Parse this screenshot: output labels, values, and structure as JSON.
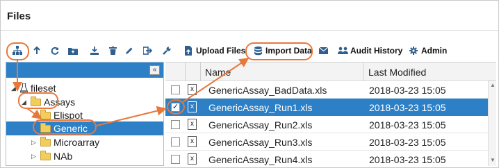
{
  "panel": {
    "title": "Files"
  },
  "toolbar": {
    "upload_label": "Upload Files",
    "import_label": "Import Data",
    "audit_label": "Audit History",
    "admin_label": "Admin"
  },
  "tree": {
    "collapse_glyph": "«",
    "root": "fileset",
    "items": [
      {
        "label": "Assays"
      },
      {
        "label": "Elispot"
      },
      {
        "label": "Generic"
      },
      {
        "label": "Microarray"
      },
      {
        "label": "NAb"
      }
    ]
  },
  "grid": {
    "columns": {
      "name": "Name",
      "modified": "Last Modified"
    },
    "rows": [
      {
        "name": "GenericAssay_BadData.xls",
        "modified": "2018-03-23 15:05",
        "checked": false
      },
      {
        "name": "GenericAssay_Run1.xls",
        "modified": "2018-03-23 15:05",
        "checked": true
      },
      {
        "name": "GenericAssay_Run2.xls",
        "modified": "2018-03-23 15:05",
        "checked": false
      },
      {
        "name": "GenericAssay_Run3.xls",
        "modified": "2018-03-23 15:05",
        "checked": false
      },
      {
        "name": "GenericAssay_Run4.xls",
        "modified": "2018-03-23 15:05",
        "checked": false
      }
    ]
  },
  "colors": {
    "selection": "#2d80c6",
    "annotation": "#e8773a",
    "toolbar_icon": "#2e5f8f"
  }
}
